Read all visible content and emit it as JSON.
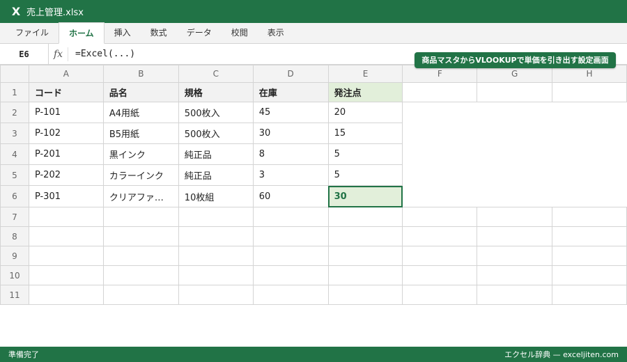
{
  "window": {
    "app_icon": "X",
    "title": "売上管理.xlsx"
  },
  "ribbon": {
    "tabs": [
      "ファイル",
      "ホーム",
      "挿入",
      "数式",
      "データ",
      "校閲",
      "表示"
    ],
    "active_index": 1
  },
  "formula_bar": {
    "name_box": "E6",
    "fx": "fx",
    "formula": "=Excel(...)"
  },
  "banner": "商品マスタからVLOOKUPで単価を引き出す設定画面",
  "sheet": {
    "columns": [
      "A",
      "B",
      "C",
      "D",
      "E",
      "F",
      "G",
      "H"
    ],
    "row_numbers": [
      "1",
      "2",
      "3",
      "4",
      "5",
      "6",
      "7",
      "8",
      "9",
      "10",
      "11"
    ],
    "headers": [
      "コード",
      "品名",
      "規格",
      "在庫",
      "発注点"
    ],
    "rows": [
      [
        "P-101",
        "A4用紙",
        "500枚入",
        "45",
        "20"
      ],
      [
        "P-102",
        "B5用紙",
        "500枚入",
        "30",
        "15"
      ],
      [
        "P-201",
        "黒インク",
        "純正品",
        "8",
        "5"
      ],
      [
        "P-202",
        "カラーインク",
        "純正品",
        "3",
        "5"
      ],
      [
        "P-301",
        "クリアファ…",
        "10枚組",
        "60",
        "30"
      ]
    ],
    "selected_cell": "E6"
  },
  "status": {
    "left": "準備完了",
    "right": "エクセル辞典 — exceljiten.com"
  },
  "colors": {
    "accent": "#217346",
    "header_fill": "#f2f2f2",
    "highlight_fill": "#e2efda"
  }
}
